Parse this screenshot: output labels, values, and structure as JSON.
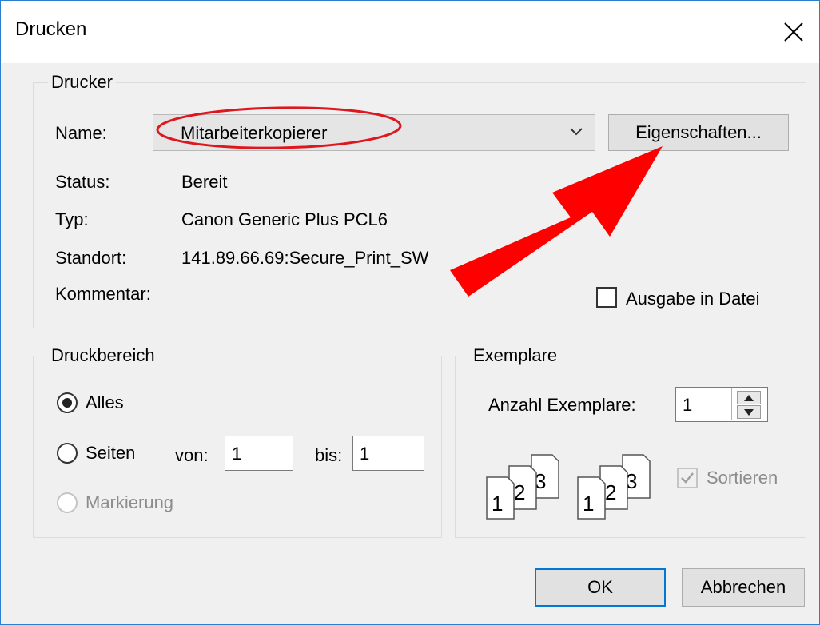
{
  "window": {
    "title": "Drucken"
  },
  "drucker": {
    "legend": "Drucker",
    "name_label": "Name:",
    "name_value": "Mitarbeiterkopierer",
    "properties_button": "Eigenschaften...",
    "status_label": "Status:",
    "status_value": "Bereit",
    "typ_label": "Typ:",
    "typ_value": "Canon Generic Plus PCL6",
    "standort_label": "Standort:",
    "standort_value": "141.89.66.69:Secure_Print_SW",
    "kommentar_label": "Kommentar:",
    "print_to_file_label": "Ausgabe in Datei",
    "print_to_file_checked": false
  },
  "druckbereich": {
    "legend": "Druckbereich",
    "alles_label": "Alles",
    "seiten_label": "Seiten",
    "markierung_label": "Markierung",
    "selected": "Alles",
    "von_label": "von:",
    "von_value": "1",
    "bis_label": "bis:",
    "bis_value": "1"
  },
  "exemplare": {
    "legend": "Exemplare",
    "count_label": "Anzahl Exemplare:",
    "count_value": "1",
    "collate_label": "Sortieren",
    "collate_checked": true,
    "collate_enabled": false,
    "page_numbers": [
      "1",
      "2",
      "3"
    ]
  },
  "buttons": {
    "ok": "OK",
    "cancel": "Abbrechen"
  },
  "colors": {
    "accent": "#0078d7",
    "annotation": "#ff0000",
    "window_border": "#2b7fd0"
  }
}
